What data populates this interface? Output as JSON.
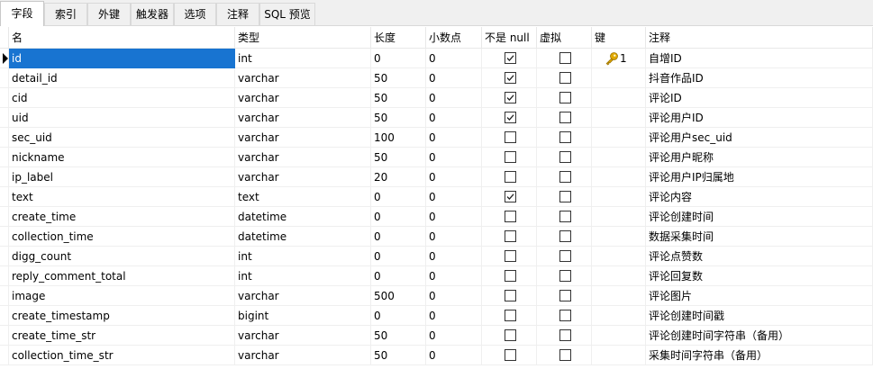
{
  "tabs": [
    {
      "label": "字段",
      "active": true
    },
    {
      "label": "索引",
      "active": false
    },
    {
      "label": "外键",
      "active": false
    },
    {
      "label": "触发器",
      "active": false
    },
    {
      "label": "选项",
      "active": false
    },
    {
      "label": "注释",
      "active": false
    },
    {
      "label": "SQL 预览",
      "active": false
    }
  ],
  "columns": [
    "名",
    "类型",
    "长度",
    "小数点",
    "不是 null",
    "虚拟",
    "键",
    "注释"
  ],
  "rows": [
    {
      "name": "id",
      "type": "int",
      "length": "0",
      "decimals": "0",
      "not_null": true,
      "virtual": false,
      "key": "1",
      "comment": "自增ID"
    },
    {
      "name": "detail_id",
      "type": "varchar",
      "length": "50",
      "decimals": "0",
      "not_null": true,
      "virtual": false,
      "key": "",
      "comment": "抖音作品ID"
    },
    {
      "name": "cid",
      "type": "varchar",
      "length": "50",
      "decimals": "0",
      "not_null": true,
      "virtual": false,
      "key": "",
      "comment": "评论ID"
    },
    {
      "name": "uid",
      "type": "varchar",
      "length": "50",
      "decimals": "0",
      "not_null": true,
      "virtual": false,
      "key": "",
      "comment": "评论用户ID"
    },
    {
      "name": "sec_uid",
      "type": "varchar",
      "length": "100",
      "decimals": "0",
      "not_null": false,
      "virtual": false,
      "key": "",
      "comment": "评论用户sec_uid"
    },
    {
      "name": "nickname",
      "type": "varchar",
      "length": "50",
      "decimals": "0",
      "not_null": false,
      "virtual": false,
      "key": "",
      "comment": "评论用户昵称"
    },
    {
      "name": "ip_label",
      "type": "varchar",
      "length": "20",
      "decimals": "0",
      "not_null": false,
      "virtual": false,
      "key": "",
      "comment": "评论用户IP归属地"
    },
    {
      "name": "text",
      "type": "text",
      "length": "0",
      "decimals": "0",
      "not_null": true,
      "virtual": false,
      "key": "",
      "comment": "评论内容"
    },
    {
      "name": "create_time",
      "type": "datetime",
      "length": "0",
      "decimals": "0",
      "not_null": false,
      "virtual": false,
      "key": "",
      "comment": "评论创建时间"
    },
    {
      "name": "collection_time",
      "type": "datetime",
      "length": "0",
      "decimals": "0",
      "not_null": false,
      "virtual": false,
      "key": "",
      "comment": "数据采集时间"
    },
    {
      "name": "digg_count",
      "type": "int",
      "length": "0",
      "decimals": "0",
      "not_null": false,
      "virtual": false,
      "key": "",
      "comment": "评论点赞数"
    },
    {
      "name": "reply_comment_total",
      "type": "int",
      "length": "0",
      "decimals": "0",
      "not_null": false,
      "virtual": false,
      "key": "",
      "comment": "评论回复数"
    },
    {
      "name": "image",
      "type": "varchar",
      "length": "500",
      "decimals": "0",
      "not_null": false,
      "virtual": false,
      "key": "",
      "comment": "评论图片"
    },
    {
      "name": "create_timestamp",
      "type": "bigint",
      "length": "0",
      "decimals": "0",
      "not_null": false,
      "virtual": false,
      "key": "",
      "comment": "评论创建时间戳"
    },
    {
      "name": "create_time_str",
      "type": "varchar",
      "length": "50",
      "decimals": "0",
      "not_null": false,
      "virtual": false,
      "key": "",
      "comment": "评论创建时间字符串（备用）"
    },
    {
      "name": "collection_time_str",
      "type": "varchar",
      "length": "50",
      "decimals": "0",
      "not_null": false,
      "virtual": false,
      "key": "",
      "comment": "采集时间字符串（备用）"
    }
  ],
  "selected_row": 0,
  "colors": {
    "selection": "#1874d1",
    "key_icon": "#e0a800"
  },
  "icons": {
    "key": "key-icon",
    "row_pointer": "current-row-pointer-icon",
    "checkbox": "checkbox-icon"
  }
}
